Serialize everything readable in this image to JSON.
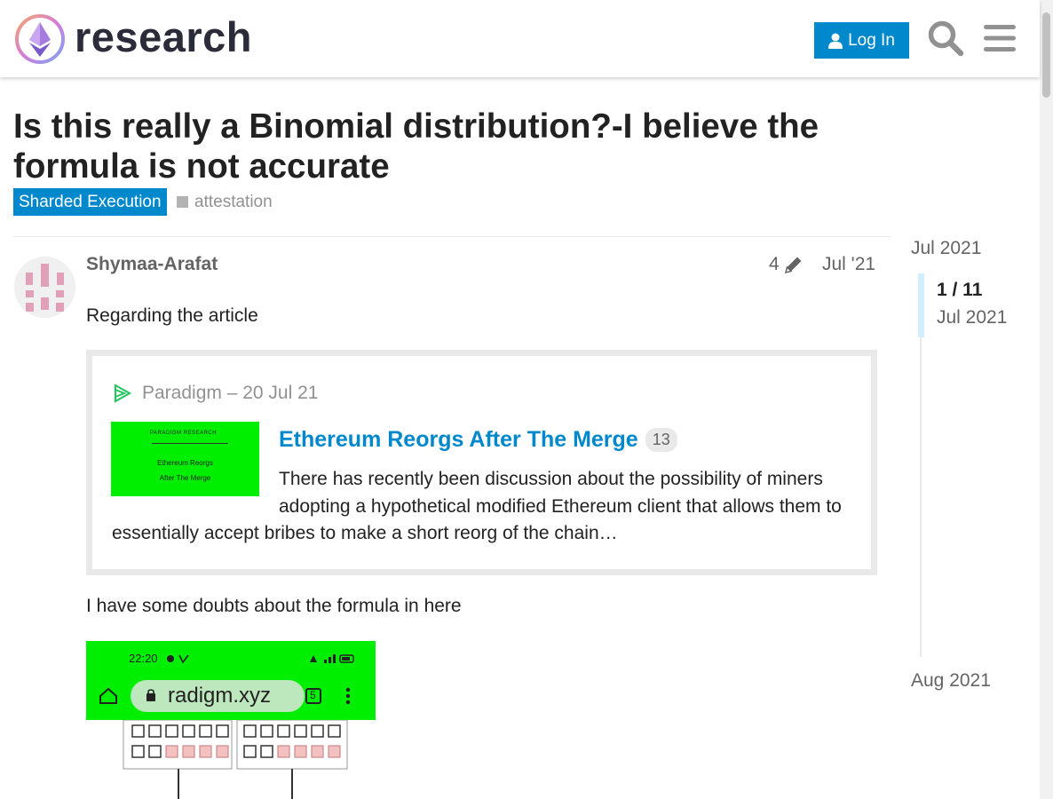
{
  "header": {
    "logo_text": "research",
    "login_label": "Log In",
    "icons": [
      "logo-icon",
      "user-icon",
      "search-icon",
      "hamburger-menu-icon"
    ],
    "accent_color": "#0088cc"
  },
  "topic": {
    "title": "Is this really a Binomial distribution?-I believe the formula is not accurate",
    "category": "Sharded Execution",
    "tag": "attestation"
  },
  "post": {
    "username": "Shymaa-Arafat",
    "edit_count": "4",
    "date": "Jul '21",
    "paragraph_1": "Regarding the article",
    "paragraph_2": "I have some doubts about the formula in here",
    "onebox": {
      "source": "Paradigm – 20 Jul 21",
      "thumb_brand": "PARADIGM RESEARCH",
      "thumb_title_1": "Ethereum Reorgs",
      "thumb_title_2": "After The Merge",
      "title": "Ethereum Reorgs After The Merge",
      "link_count": "13",
      "description": "There has recently been discussion about the possibility of miners adopting a hypothetical modified Ethereum client that allows them to essentially accept bribes to make a short reorg of the chain…"
    },
    "image": {
      "status_time": "22:20",
      "url_text": "radigm.xyz",
      "tab_count": "5"
    }
  },
  "timeline": {
    "start_label": "Jul 2021",
    "position": "1 / 11",
    "position_date": "Jul 2021",
    "end_label": "Aug 2021"
  }
}
